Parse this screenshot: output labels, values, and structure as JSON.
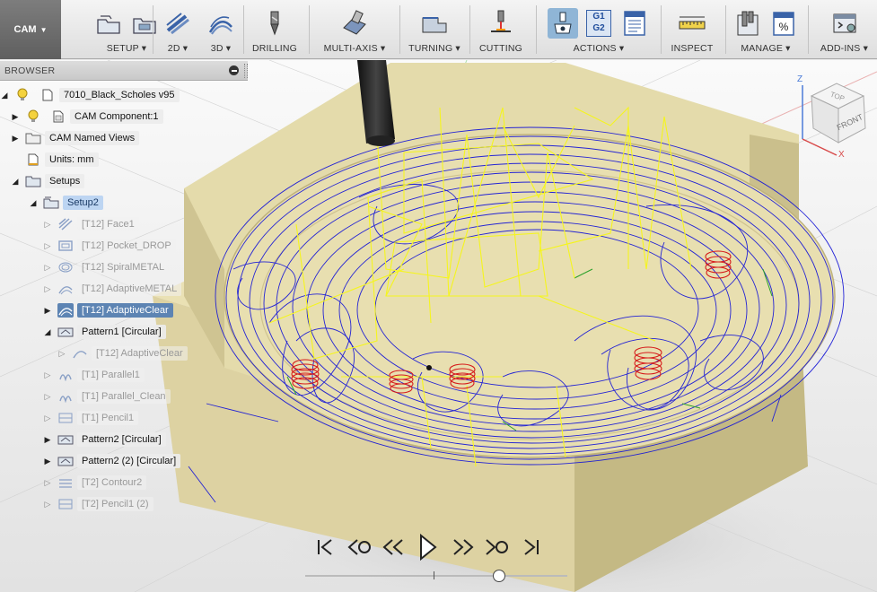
{
  "toolbar": {
    "workspace": "CAM",
    "groups": [
      {
        "label": "SETUP ▾"
      },
      {
        "label": "2D ▾"
      },
      {
        "label": "3D ▾"
      },
      {
        "label": "DRILLING"
      },
      {
        "label": "MULTI-AXIS ▾"
      },
      {
        "label": "TURNING ▾"
      },
      {
        "label": "CUTTING"
      },
      {
        "label": "ACTIONS ▾"
      },
      {
        "label": "INSPECT"
      },
      {
        "label": "MANAGE ▾"
      },
      {
        "label": "ADD-INS ▾"
      }
    ],
    "actions_g1": "G1",
    "actions_g2": "G2"
  },
  "browser": {
    "title": "BROWSER",
    "items": [
      {
        "label": "7010_Black_Scholes v95"
      },
      {
        "label": "CAM Component:1"
      },
      {
        "label": "CAM Named Views"
      },
      {
        "label": "Units: mm"
      },
      {
        "label": "Setups"
      },
      {
        "label": "Setup2"
      },
      {
        "label": "[T12] Face1"
      },
      {
        "label": "[T12] Pocket_DROP"
      },
      {
        "label": "[T12] SpiralMETAL"
      },
      {
        "label": "[T12] AdaptiveMETAL"
      },
      {
        "label": "[T12] AdaptiveClear"
      },
      {
        "label": "Pattern1 [Circular]"
      },
      {
        "label": "[T12] AdaptiveClear"
      },
      {
        "label": "[T1] Parallel1"
      },
      {
        "label": "[T1] Parallel_Clean"
      },
      {
        "label": "[T1] Pencil1"
      },
      {
        "label": "Pattern2 [Circular]"
      },
      {
        "label": "Pattern2 (2) [Circular]"
      },
      {
        "label": "[T2] Contour2"
      },
      {
        "label": "[T2] Pencil1 (2)"
      }
    ]
  },
  "viewcube": {
    "top": "TOP",
    "front": "FRONT",
    "x": "X",
    "z": "Z"
  },
  "playback": {
    "buttons": [
      "skip-to-start",
      "previous-operation",
      "step-back",
      "play",
      "step-forward",
      "next-operation",
      "skip-to-end"
    ],
    "progress": 0.74
  },
  "colors": {
    "toolpath_feed": "#1a1ad6",
    "toolpath_rapid": "#f5f51e",
    "toolpath_plunge": "#d61a1a",
    "stock": "#d9cf9f",
    "selection": "#5d84b3"
  }
}
